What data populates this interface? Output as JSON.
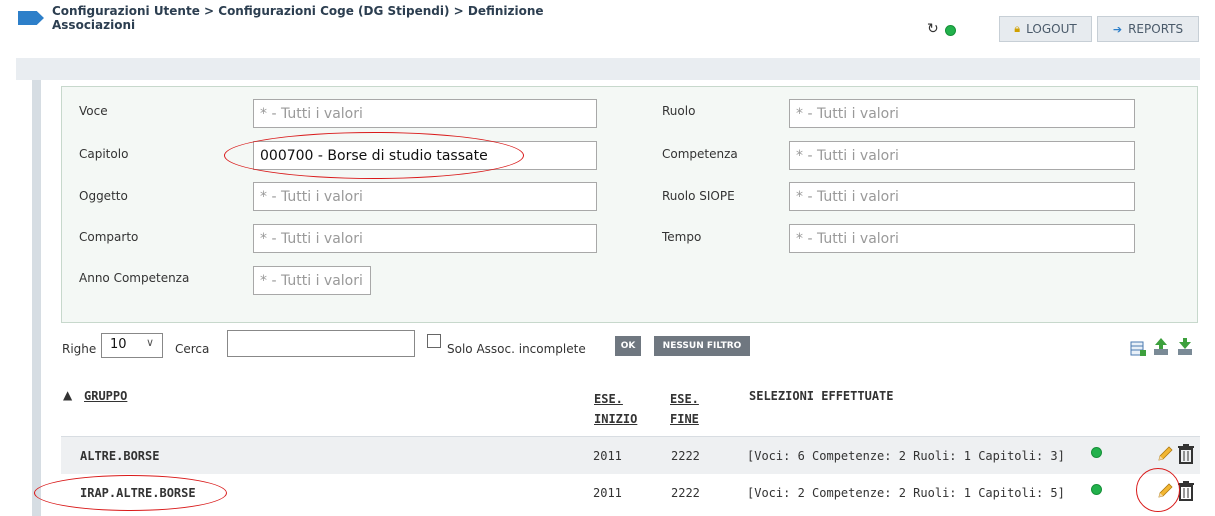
{
  "header": {
    "breadcrumb_line1": "Configurazioni Utente > Configurazioni Coge (DG Stipendi) > Definizione",
    "breadcrumb_line2": "Associazioni",
    "refresh_icon": "refresh-icon",
    "logout_label": "LOGOUT",
    "reports_label": "REPORTS"
  },
  "filters": {
    "voce": {
      "label": "Voce",
      "value": "* - Tutti i valori"
    },
    "capitolo": {
      "label": "Capitolo",
      "value": "000700 - Borse di studio tassate"
    },
    "oggetto": {
      "label": "Oggetto",
      "value": "* - Tutti i valori"
    },
    "comparto": {
      "label": "Comparto",
      "value": "* - Tutti i valori"
    },
    "anno_competenza": {
      "label": "Anno Competenza",
      "value": "* - Tutti i valori"
    },
    "ruolo": {
      "label": "Ruolo",
      "value": "* - Tutti i valori"
    },
    "competenza": {
      "label": "Competenza",
      "value": "* - Tutti i valori"
    },
    "ruolo_siope": {
      "label": "Ruolo SIOPE",
      "value": "* - Tutti i valori"
    },
    "tempo": {
      "label": "Tempo",
      "value": "* - Tutti i valori"
    }
  },
  "toolbar": {
    "righe_label": "Righe",
    "righe_value": "10",
    "cerca_label": "Cerca",
    "cerca_value": "",
    "solo_label": "Solo Assoc. incomplete",
    "ok_label": "OK",
    "nessun_filtro_label": "NESSUN FILTRO"
  },
  "table": {
    "col_gruppo": "GRUPPO",
    "col_ese_inizio_1": "ESE.",
    "col_ese_inizio_2": "INIZIO",
    "col_ese_fine_1": "ESE.",
    "col_ese_fine_2": "FINE",
    "col_selezioni": "SELEZIONI EFFETTUATE",
    "rows": [
      {
        "gruppo": "ALTRE.BORSE",
        "inizio": "2011",
        "fine": "2222",
        "selezioni": "[Voci: 6 Competenze: 2 Ruoli: 1 Capitoli: 3]"
      },
      {
        "gruppo": "IRAP.ALTRE.BORSE",
        "inizio": "2011",
        "fine": "2222",
        "selezioni": "[Voci: 2 Competenze: 2 Ruoli: 1 Capitoli: 5]"
      }
    ]
  },
  "colors": {
    "accent": "#2d7fc9",
    "status_ok": "#22b14c",
    "annotation": "#d91a1a"
  }
}
